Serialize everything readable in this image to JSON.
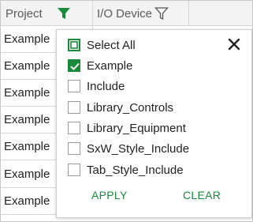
{
  "columns": {
    "project": {
      "label": "Project",
      "filter_active": true
    },
    "io_device": {
      "label": "I/O Device",
      "filter_active": false
    }
  },
  "rows": [
    "Example",
    "Example",
    "Example",
    "Example",
    "Example",
    "Example",
    "Example"
  ],
  "filter_popup": {
    "select_all_label": "Select All",
    "select_all_state": "indeterminate",
    "options": [
      {
        "label": "Example",
        "checked": true
      },
      {
        "label": "Include",
        "checked": false
      },
      {
        "label": "Library_Controls",
        "checked": false
      },
      {
        "label": "Library_Equipment",
        "checked": false
      },
      {
        "label": "SxW_Style_Include",
        "checked": false
      },
      {
        "label": "Tab_Style_Include",
        "checked": false
      }
    ],
    "apply_label": "APPLY",
    "clear_label": "CLEAR"
  },
  "colors": {
    "accent": "#1b8a3a",
    "header_bg": "#f3f3f3",
    "border": "#d6d6d6"
  },
  "icons": {
    "active_filter": "filter-icon-filled",
    "inactive_filter": "filter-icon-outline",
    "close": "close-icon"
  }
}
